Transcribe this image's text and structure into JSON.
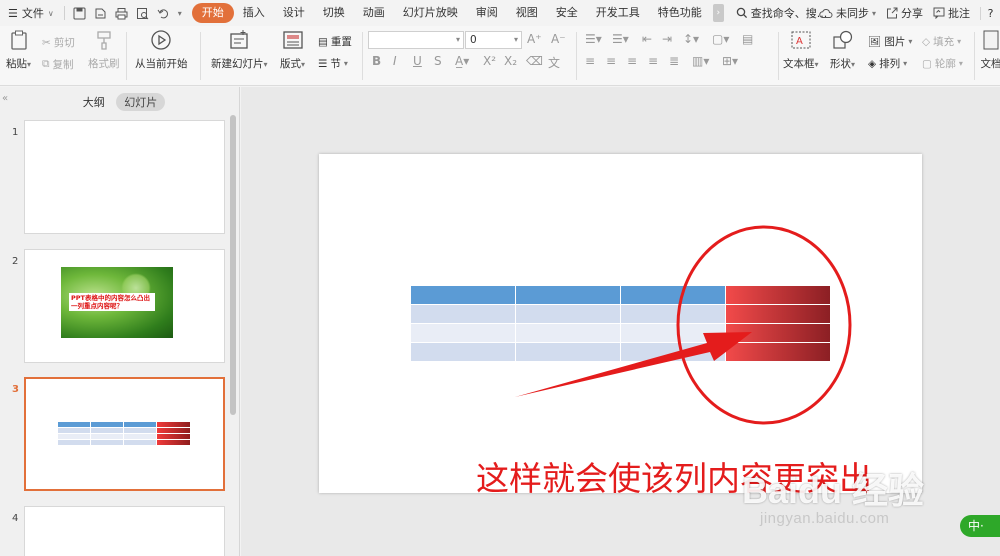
{
  "menubar": {
    "file_label": "文件",
    "tabs": [
      "开始",
      "插入",
      "设计",
      "切换",
      "动画",
      "幻灯片放映",
      "审阅",
      "视图",
      "安全",
      "开发工具",
      "特色功能"
    ],
    "active_tab": "开始",
    "more_label": "›",
    "search_label": "查找命令、搜...",
    "sync_label": "未同步",
    "share_label": "分享",
    "comment_label": "批注",
    "help_label": "?"
  },
  "ribbon": {
    "paste": "粘贴",
    "cut": "剪切",
    "copy": "复制",
    "format_painter": "格式刷",
    "from_current": "从当前开始",
    "new_slide": "新建幻灯片",
    "layout": "版式",
    "reset": "重置",
    "section": "节",
    "font_size_value": "0",
    "text_box": "文本框",
    "shape": "形状",
    "picture": "图片",
    "arrange": "排列",
    "fill": "填充",
    "outline": "轮廓",
    "doc_label": "文档"
  },
  "panel": {
    "tab_outline": "大纲",
    "tab_slides": "幻灯片",
    "slide_numbers": [
      "1",
      "2",
      "3",
      "4"
    ],
    "slide2_text": "PPT表格中的内容怎么凸出一列重点内容呢？"
  },
  "slide": {
    "caption": "这样就会使该列内容更突出"
  },
  "watermark": {
    "logo": "Baidu 经验",
    "url": "jingyan.baidu.com"
  },
  "ime": {
    "label": "中·"
  },
  "colors": {
    "accent": "#e2703a",
    "table_header": "#5b9bd5",
    "table_row_a": "#d2dcee",
    "table_row_b": "#e9edf6",
    "highlight_red": "#e41c1c"
  }
}
